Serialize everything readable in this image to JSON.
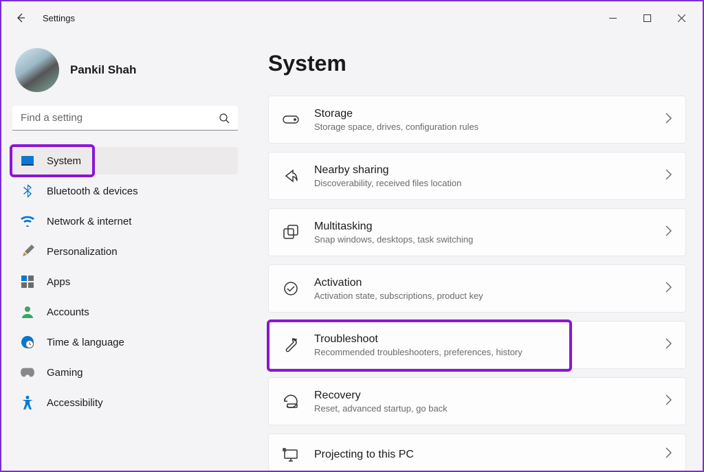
{
  "window": {
    "title": "Settings"
  },
  "user": {
    "name": "Pankil Shah"
  },
  "search": {
    "placeholder": "Find a setting"
  },
  "nav": {
    "items": [
      {
        "label": "System"
      },
      {
        "label": "Bluetooth & devices"
      },
      {
        "label": "Network & internet"
      },
      {
        "label": "Personalization"
      },
      {
        "label": "Apps"
      },
      {
        "label": "Accounts"
      },
      {
        "label": "Time & language"
      },
      {
        "label": "Gaming"
      },
      {
        "label": "Accessibility"
      }
    ]
  },
  "page": {
    "title": "System"
  },
  "cards": [
    {
      "title": "Storage",
      "sub": "Storage space, drives, configuration rules"
    },
    {
      "title": "Nearby sharing",
      "sub": "Discoverability, received files location"
    },
    {
      "title": "Multitasking",
      "sub": "Snap windows, desktops, task switching"
    },
    {
      "title": "Activation",
      "sub": "Activation state, subscriptions, product key"
    },
    {
      "title": "Troubleshoot",
      "sub": "Recommended troubleshooters, preferences, history"
    },
    {
      "title": "Recovery",
      "sub": "Reset, advanced startup, go back"
    },
    {
      "title": "Projecting to this PC",
      "sub": ""
    }
  ]
}
